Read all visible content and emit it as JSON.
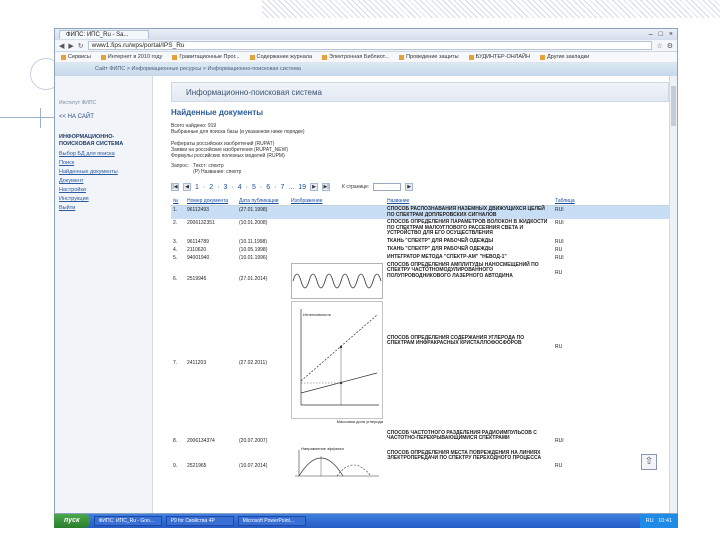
{
  "browser": {
    "tab_title": "ФИПС: ИПС_Ru - Sa...",
    "address": "www1.fips.ru/wps/portal/IPS_Ru",
    "bookmarks": [
      "Сервисы",
      "Интернет в 2010 году",
      "Гравитационные Прог...",
      "Содержание журнала",
      "Электронная Библиот...",
      "Проведение защиты",
      "БУДИНТЕР-ОНЛАЙН",
      "Другие закладки"
    ]
  },
  "site": {
    "breadcrumb": "Сайт ФИПС > Информационные ресурсы > Информационно-поисковая система"
  },
  "sidebar": {
    "subtitle": "Институт ФИПС",
    "back": "<< НА САЙТ",
    "heading": "ИНФОРМАЦИОННО-ПОИСКОВАЯ СИСТЕМА",
    "items": [
      "Выбор БД для поиска",
      "Поиск",
      "Найденные документы",
      "Документ",
      "Настройки",
      "Инструкция",
      "Выйти"
    ]
  },
  "main": {
    "system_title": "Информационно-поисковая система",
    "found_title": "Найденные документы",
    "found_count": "Всего найдено: 919",
    "selected_bases": "Выбранные для поиска базы (в указанном ниже порядке)",
    "bases": [
      "Рефераты российских изобретений (RUPAT)",
      "Заявки на российские изобретения (RUPAT_NEW)",
      "Формулы российских полезных моделей (RUPM)"
    ],
    "request_label": "Запрос:",
    "request_lines": [
      "Текст: спектр",
      "(Р) Название: спектр"
    ],
    "pages": [
      "1",
      "2",
      "3",
      "4",
      "5",
      "6",
      "7",
      "...",
      "19"
    ],
    "goto_label": "К странице:"
  },
  "table": {
    "headers": [
      "№",
      "Номер документа",
      "Дата публикации",
      "Изображение",
      "Название",
      "Таблица"
    ],
    "rows": [
      {
        "n": "1.",
        "num": "96112493",
        "date": "(27.01.1998)",
        "title": "СПОСОБ РАСПОЗНАВАНИЯ НАЗЕМНЫХ ДВИЖУЩИХСЯ ЦЕЛЕЙ ПО СПЕКТРАМ ДОПЛЕРОВСКИХ СИГНАЛОВ",
        "tbl": "RUI"
      },
      {
        "n": "2.",
        "num": "2006132351",
        "date": "(10.01.2008)",
        "title": "СПОСОБ ОПРЕДЕЛЕНИЯ ПАРАМЕТРОВ ВОЛОКОН В ЖИДКОСТИ ПО СПЕКТРАМ МАЛОУГЛОВОГО РАССЕЯНИЯ СВЕТА И УСТРОЙСТВО ДЛЯ ЕГО ОСУЩЕСТВЛЕНИЯ",
        "tbl": "RUI"
      },
      {
        "n": "3.",
        "num": "96114789",
        "date": "(10.11.1998)",
        "title": "ТКАНЬ \"СПЕКТР\" ДЛЯ РАБОЧЕЙ ОДЕЖДЫ",
        "tbl": "RUI"
      },
      {
        "n": "4.",
        "num": "2110620",
        "date": "(10.05.1998)",
        "title": "ТКАНЬ \"СПЕКТР\" ДЛЯ РАБОЧЕЙ ОДЕЖДЫ",
        "tbl": "RU"
      },
      {
        "n": "5.",
        "num": "94001940",
        "date": "(10.01.1996)",
        "title": "ИНТЕГРАТОР МЕТОДА \"СПЕКТР-АМ\" \"НЕВОД-1\"",
        "tbl": "RUI"
      },
      {
        "n": "6.",
        "num": "2519945",
        "date": "(27.01.2014)",
        "title": "СПОСОБ ОПРЕДЕЛЕНИЯ АМПЛИТУДЫ НАНОСМЕЩЕНИЙ ПО СПЕКТРУ ЧАСТОТНОМОДУЛИРОВАННОГО ПОЛУПРОВОДНИКОВОГО ЛАЗЕРНОГО АВТОДИНА",
        "tbl": "RU"
      },
      {
        "n": "7.",
        "num": "2411203",
        "date": "(27.02.2011)",
        "title": "СПОСОБ ОПРЕДЕЛЕНИЯ СОДЕРЖАНИЯ УГЛЕРОДА ПО СПЕКТРАМ ИНФРАКРАСНЫХ КРИСТАЛЛОФОСФОРОВ",
        "tbl": "RU"
      },
      {
        "n": "8.",
        "num": "2006134374",
        "date": "(20.07.2007)",
        "title": "СПОСОБ ЧАСТОТНОГО РАЗДЕЛЕНИЯ РАДИОИМПУЛЬСОВ С ЧАСТОТНО-ПЕРЕКРЫВАЮЩИМИСЯ СПЕКТРАМИ",
        "tbl": "RUI"
      },
      {
        "n": "9.",
        "num": "2521965",
        "date": "(10.07.2014)",
        "title": "СПОСОБ ОПРЕДЕЛЕНИЯ МЕСТА ПОВРЕЖДЕНИЯ НА ЛИНИЯХ ЭЛЕКТРОПЕРЕДАЧИ ПО СПЕКТРУ ПЕРЕХОДНОГО ПРОЦЕССА",
        "tbl": "RU"
      }
    ]
  },
  "figures": {
    "fig2_ylabel": "Интенсивность",
    "fig2_xlabel": "Массовая доля углерода",
    "fig3_label": "Направление эффекта"
  },
  "taskbar": {
    "start": "пуск",
    "tasks": [
      "ФИПС: ИПС_Ru - Goo...",
      "P9 for Свойства 4P",
      "Microsoft PowerPoint..."
    ],
    "lang": "RU",
    "time": "10:41"
  }
}
